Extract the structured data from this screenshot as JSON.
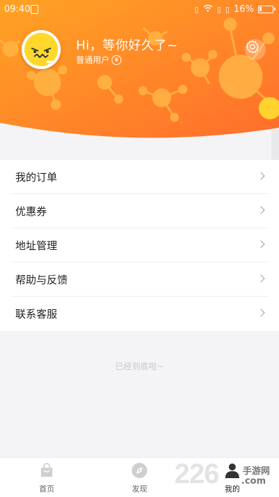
{
  "status_bar": {
    "time": "09:40",
    "battery": "16%"
  },
  "header": {
    "greeting": "Hi，等你好久了~",
    "user_type": "普通用户",
    "colors": {
      "start": "#ffa324",
      "end": "#ff7a2b"
    }
  },
  "menu": {
    "items": [
      {
        "label": "我的订单"
      },
      {
        "label": "优惠券"
      },
      {
        "label": "地址管理"
      },
      {
        "label": "帮助与反馈"
      },
      {
        "label": "联系客服"
      }
    ]
  },
  "footer_note": "已经到底啦~",
  "tabbar": {
    "tabs": [
      {
        "label": "首页",
        "icon": "bag-icon"
      },
      {
        "label": "发现",
        "icon": "compass-icon"
      },
      {
        "label": "我的",
        "icon": "person-icon",
        "active": true
      }
    ]
  },
  "watermark": {
    "number": "226",
    "text": "手游网",
    "sub": ".com"
  }
}
